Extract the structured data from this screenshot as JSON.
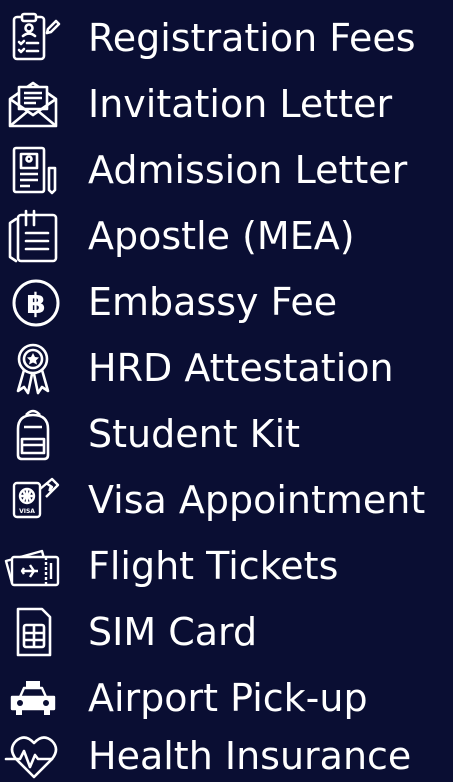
{
  "colors": {
    "background": "#0a0e33",
    "text": "#ffffff"
  },
  "items": [
    {
      "label": "Registration Fees",
      "icon": "clipboard-checklist-icon"
    },
    {
      "label": "Invitation Letter",
      "icon": "envelope-letter-icon"
    },
    {
      "label": "Admission Letter",
      "icon": "document-id-icon"
    },
    {
      "label": "Apostle (MEA)",
      "icon": "clipped-document-icon"
    },
    {
      "label": "Embassy Fee",
      "icon": "baht-coin-icon"
    },
    {
      "label": "HRD Attestation",
      "icon": "award-ribbon-icon"
    },
    {
      "label": "Student Kit",
      "icon": "backpack-icon"
    },
    {
      "label": "Visa Appointment",
      "icon": "visa-passport-icon"
    },
    {
      "label": "Flight Tickets",
      "icon": "plane-ticket-icon"
    },
    {
      "label": "SIM Card",
      "icon": "sim-card-icon"
    },
    {
      "label": "Airport Pick-up",
      "icon": "taxi-icon"
    },
    {
      "label": "Health Insurance",
      "icon": "heart-pulse-icon"
    }
  ]
}
